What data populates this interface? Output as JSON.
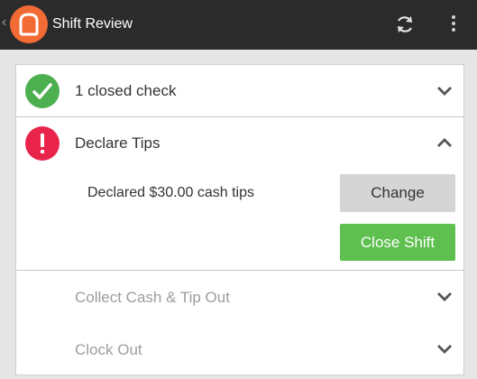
{
  "appbar": {
    "title": "Shift Review",
    "back_glyph": "‹",
    "logo_icon": "toast-logo-icon",
    "refresh_icon": "refresh-icon",
    "overflow_icon": "more-vert-icon",
    "background": "#2b2b2b"
  },
  "steps": [
    {
      "label": "1 closed check",
      "status": "complete",
      "expanded": false,
      "status_color": "#4caf50"
    },
    {
      "label": "Declare Tips",
      "status": "attention",
      "expanded": true,
      "status_color": "#e8244b"
    },
    {
      "label": "Collect Cash & Tip Out",
      "status": "pending",
      "expanded": false
    },
    {
      "label": "Clock Out",
      "status": "pending",
      "expanded": false
    }
  ],
  "declare_tips": {
    "declared_text": "Declared $30.00 cash tips",
    "change_label": "Change",
    "close_shift_label": "Close Shift"
  },
  "colors": {
    "brand_orange": "#f26a34",
    "close_button": "#5fbf4f",
    "change_button": "#d5d5d5"
  }
}
